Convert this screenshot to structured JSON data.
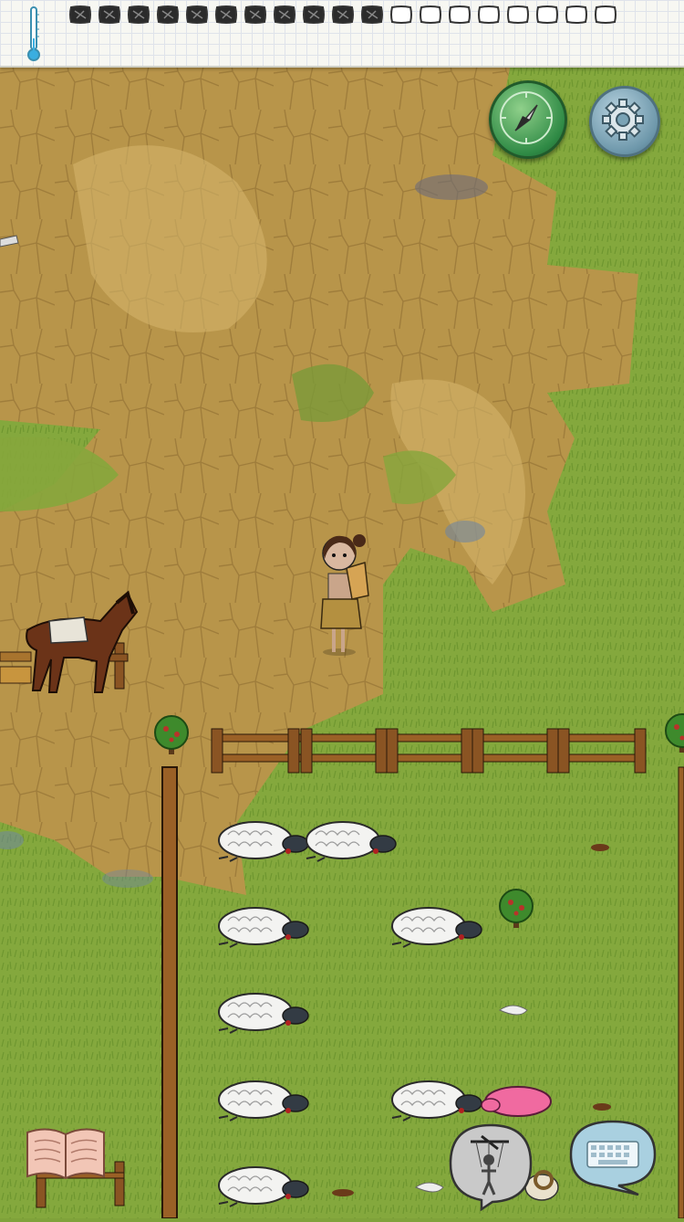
{
  "hud": {
    "temperature_icon": "thermometer-icon",
    "food_meter": {
      "total": 19,
      "filled": 11,
      "filled_color": "#2b2b2b",
      "empty_color": "#ffffff"
    }
  },
  "buttons": {
    "compass": {
      "icon": "compass-icon",
      "color": "#3a8f4a"
    },
    "settings": {
      "icon": "gear-icon",
      "color": "#7aa3b5"
    },
    "recipe_book": {
      "icon": "open-book-icon"
    },
    "emote": {
      "icon": "puppet-icon"
    },
    "chat": {
      "icon": "keyboard-icon"
    }
  },
  "scene": {
    "terrain": [
      "dirt-path",
      "grassland"
    ],
    "colors": {
      "dirt": "#b8954a",
      "grass": "#84a83d",
      "fence": "#8a5423",
      "wool": "#f2f2f2"
    },
    "entities": {
      "player": "girl-with-backpack",
      "horse": "saddled-horse",
      "sheep_count": 9,
      "pink_shorn_sheep": 1,
      "ram": 1,
      "fruit_bushes": 3,
      "fence": "wooden-rail-fence"
    }
  }
}
